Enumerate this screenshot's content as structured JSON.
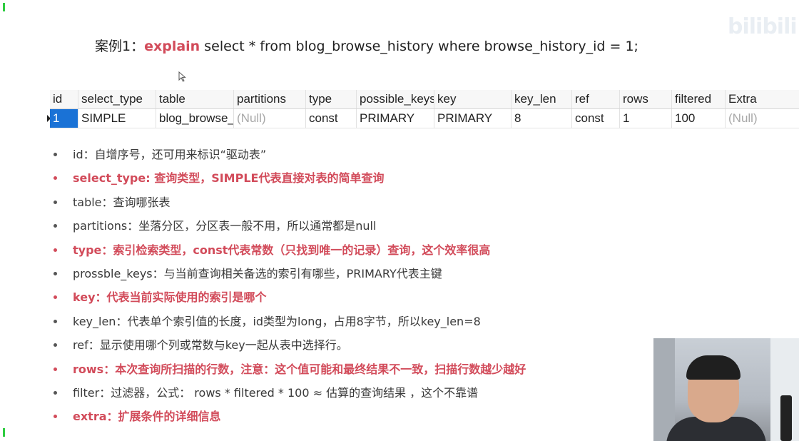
{
  "case": {
    "prefix": "案例1：",
    "keyword": "explain",
    "sql": " select * from blog_browse_history where browse_history_id = 1;"
  },
  "watermark": "bilibili",
  "grid": {
    "headers": [
      "id",
      "select_type",
      "table",
      "partitions",
      "type",
      "possible_keys",
      "key",
      "key_len",
      "ref",
      "rows",
      "filtered",
      "Extra"
    ],
    "row": [
      "1",
      "SIMPLE",
      "blog_browse_history",
      "(Null)",
      "const",
      "PRIMARY",
      "PRIMARY",
      "8",
      "const",
      "1",
      "100",
      "(Null)"
    ]
  },
  "bullets": [
    {
      "text": "id：自增序号，还可用来标识“驱动表”",
      "highlight": false
    },
    {
      "text": "select_type: 查询类型，SIMPLE代表直接对表的简单查询",
      "highlight": true
    },
    {
      "text": "table：查询哪张表",
      "highlight": false
    },
    {
      "text": "partitions：坐落分区，分区表一般不用，所以通常都是null",
      "highlight": false
    },
    {
      "text": "type：索引检索类型，const代表常数（只找到唯一的记录）查询，这个效率很高",
      "highlight": true
    },
    {
      "text": "prossble_keys：与当前查询相关备选的索引有哪些，PRIMARY代表主键",
      "highlight": false
    },
    {
      "text": "key：代表当前实际使用的索引是哪个",
      "highlight": true
    },
    {
      "text": "key_len：代表单个索引值的长度，id类型为long，占用8字节，所以key_len=8",
      "highlight": false
    },
    {
      "text": "ref：显示使用哪个列或常数与key一起从表中选择行。",
      "highlight": false
    },
    {
      "text": "rows：本次查询所扫描的行数，注意：这个值可能和最终结果不一致，扫描行数越少越好",
      "highlight": true
    },
    {
      "text": "filter：过滤器，公式： rows * filtered * 100 ≈ 估算的查询结果 ，这个不靠谱",
      "highlight": false
    },
    {
      "text": "extra：扩展条件的详细信息",
      "highlight": true
    }
  ],
  "colors": {
    "highlight": "#d24b5a",
    "selection": "#1a72d6",
    "null_text": "#a8a8a8"
  }
}
